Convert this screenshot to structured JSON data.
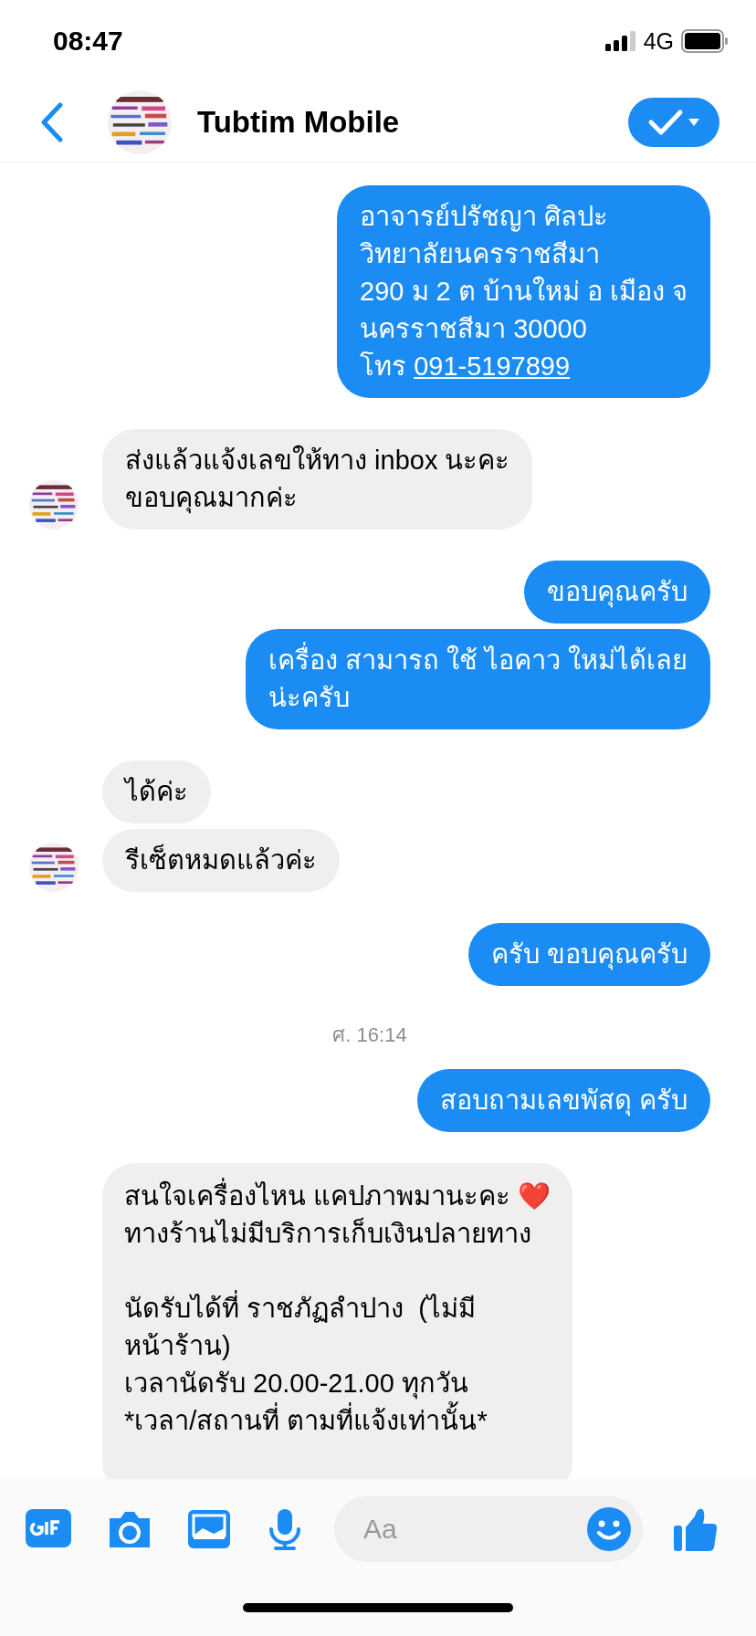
{
  "status_bar": {
    "time": "08:47",
    "network": "4G"
  },
  "header": {
    "title": "Tubtim Mobile"
  },
  "messages": [
    {
      "kind": "out",
      "text": "อาจารย์ปรัชญา ศิลปะ\nวิทยาลัยนครราชสีมา\n290 ม 2 ต บ้านใหม่ อ เมือง จ\nนครราชสีมา 30000\nโทร ",
      "link": "091-5197899"
    },
    {
      "kind": "in",
      "text": "ส่งแล้วแจ้งเลขให้ทาง inbox นะคะ\nขอบคุณมากค่ะ",
      "avatar": true
    },
    {
      "kind": "out",
      "text": "ขอบคุณครับ"
    },
    {
      "kind": "out",
      "text": "เครื่อง สามารถ ใช้ ไอคาว ใหม่ได้เลย\nน่ะครับ"
    },
    {
      "kind": "in",
      "text": "ได้ค่ะ",
      "avatar": false
    },
    {
      "kind": "in",
      "text": "รีเซ็ตหมดแล้วค่ะ",
      "avatar": true
    },
    {
      "kind": "out",
      "text": "ครับ ขอบคุณครับ"
    },
    {
      "kind": "time",
      "text": "ศ. 16:14"
    },
    {
      "kind": "out",
      "text": "สอบถามเลขพัสดุ ครับ"
    },
    {
      "kind": "in",
      "text": "สนใจเครื่องไหน แคปภาพมานะคะ ❤️\nทางร้านไม่มีบริการเก็บเงินปลายทาง\n\nนัดรับได้ที่ ราชภัฏลำปาง  (ไม่มี\nหน้าร้าน)\nเวลานัดรับ 20.00-21.00 ทุกวัน\n*เวลา/สถานที่ ตามที่แจ้งเท่านั้น*",
      "avatar": false
    }
  ],
  "composer": {
    "placeholder": "Aa"
  }
}
